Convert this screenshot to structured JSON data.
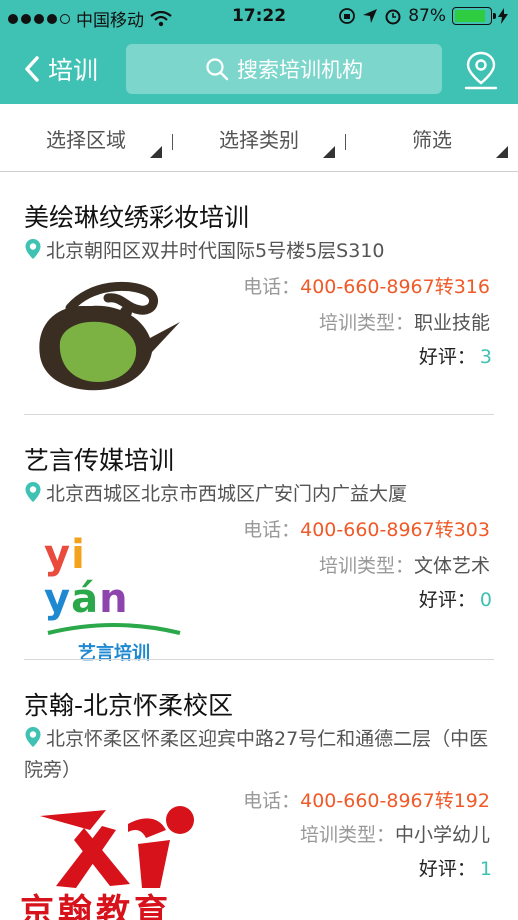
{
  "status_bar": {
    "carrier": "中国移动",
    "time": "17:22",
    "battery_text": "87%",
    "battery_level": 0.87,
    "signal_bars": 4
  },
  "nav": {
    "back_label": "培训",
    "search_placeholder": "搜索培训机构",
    "accent_color": "#3fc1b3"
  },
  "filters": [
    {
      "label": "选择区域"
    },
    {
      "label": "选择类别"
    },
    {
      "label": "筛选"
    }
  ],
  "labels": {
    "phone_prefix": "电话：",
    "type_prefix": "培训类型：",
    "rating_prefix": "好评："
  },
  "items": [
    {
      "name": "美绘琳纹绣彩妆培训",
      "address": "北京朝阳区双井时代国际5号楼5层S310",
      "phone": "400-660-8967转316",
      "type": "职业技能",
      "rating": "3",
      "logo": "teapot-logo-icon"
    },
    {
      "name": "艺言传媒培训",
      "address": "北京西城区北京市西城区广安门内广益大厦",
      "phone": "400-660-8967转303",
      "type": "文体艺术",
      "rating": "0",
      "logo": "yiyan-logo",
      "logo_text_top": "yi yán",
      "logo_text_bottom": "艺言培训"
    },
    {
      "name": "京翰-北京怀柔校区",
      "address": "北京怀柔区怀柔区迎宾中路27号仁和通德二层（中医院旁）",
      "phone": "400-660-8967转192",
      "type": "中小学幼儿",
      "rating": "1",
      "logo": "jinghan-logo",
      "logo_text": "京翰教育"
    }
  ]
}
